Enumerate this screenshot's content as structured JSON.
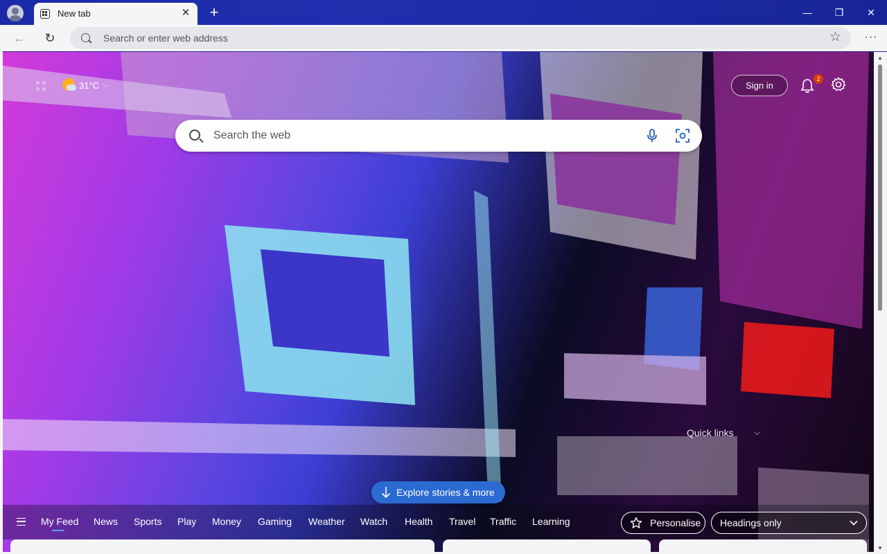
{
  "window": {
    "tab_title": "New tab",
    "new_tab_symbol": "+",
    "close_tab_symbol": "✕",
    "minimize_symbol": "—",
    "maximize_symbol": "❐",
    "close_symbol": "✕"
  },
  "toolbar": {
    "back_symbol": "←",
    "refresh_symbol": "↻",
    "address_placeholder": "Search or enter web address",
    "favorite_symbol": "☆",
    "more_symbol": "···"
  },
  "top": {
    "weather_temp": "31°C",
    "weather_chevron": "⌵",
    "sign_in": "Sign in",
    "notification_count": "2"
  },
  "search": {
    "placeholder": "Search the web"
  },
  "quick_links": {
    "label": "Quick links",
    "chevron": "⌵"
  },
  "explore": {
    "label": "Explore stories & more"
  },
  "feed": {
    "tabs": [
      "My Feed",
      "News",
      "Sports",
      "Play",
      "Money",
      "Gaming",
      "Weather",
      "Watch",
      "Health",
      "Travel",
      "Traffic",
      "Learning"
    ],
    "active_tab": "My Feed",
    "personalise": "Personalise",
    "headings_select": "Headings only"
  },
  "scrollbar": {
    "up": "▲",
    "down": "▼"
  },
  "colors": {
    "titlebar": "#1a2aa8",
    "accent_button": "#2b6bd1",
    "badge": "#d83b01",
    "active_tab_underline": "#5aa0f2"
  }
}
